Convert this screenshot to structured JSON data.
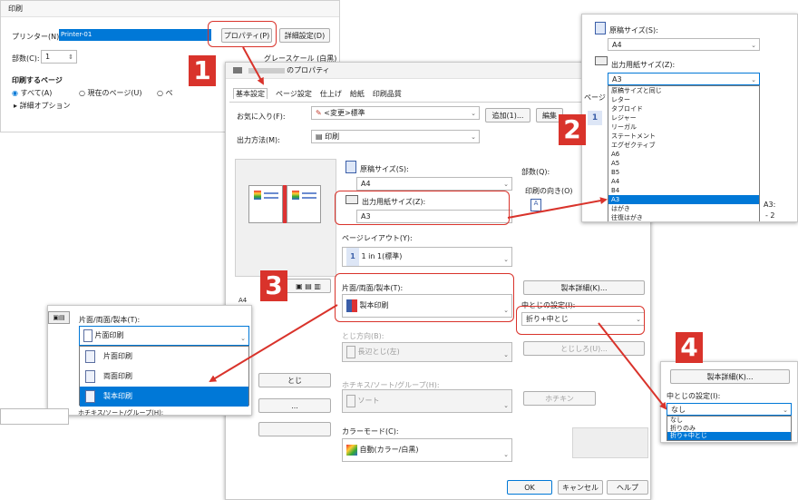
{
  "print_dialog": {
    "title": "印刷",
    "printer_label": "プリンター(N):",
    "printer_value": "Printer-01",
    "properties_button": "プロパティ(P)",
    "advanced_button": "詳細設定(D)",
    "copies_label": "部数(C):",
    "copies_value": "1",
    "grayscale_label": "グレースケール (白黒) で",
    "pages_heading": "印刷するページ",
    "radio_all": "すべて(A)",
    "radio_current": "現在のページ(U)",
    "radio_pages": "ペ",
    "more_options": "詳細オプション"
  },
  "badges": [
    "1",
    "2",
    "3",
    "4"
  ],
  "properties": {
    "title_suffix": "のプロパティ",
    "tabs": [
      "基本設定",
      "ページ設定",
      "仕上げ",
      "給紙",
      "印刷品質"
    ],
    "favorites_label": "お気に入り(F):",
    "favorites_value": "<変更>標準",
    "add_button": "追加(1)...",
    "edit_button": "編集",
    "output_label": "出力方法(M):",
    "output_value": "印刷",
    "original_size_label": "原稿サイズ(S):",
    "original_size_value": "A4",
    "copies_label": "部数(Q):",
    "orientation_label": "印刷の向き(O)",
    "output_paper_label": "出力用紙サイズ(Z):",
    "output_paper_value": "A3",
    "page_layout_label": "ページレイアウト(Y):",
    "page_layout_num": "1",
    "page_layout_value": "1 in 1(標準)",
    "sided_label": "片面/両面/製本(T):",
    "sided_value": "製本印刷",
    "booklet_detail_button": "製本詳細(K)...",
    "center_binding_label": "中とじの設定(I):",
    "center_binding_value": "折り+中とじ",
    "binding_location_label": "とじ方向(B):",
    "binding_location_value": "長辺とじ(左)",
    "binding_margin_button": "とじしろ(U)...",
    "staple_label": "ホチキス/ソート/グループ(H):",
    "staple_value": "ソート",
    "staple_button": "ホチキン",
    "color_mode_label": "カラーモード(C):",
    "color_mode_value": "自動(カラー/白黒)",
    "left_preview_button": "とじ",
    "left_button_2": "...",
    "a4_note": "A4",
    "ok_button": "OK",
    "cancel_button": "キャンセル",
    "help_button": "ヘルプ"
  },
  "paper_popup": {
    "original_size_label": "原稿サイズ(S):",
    "original_size_value": "A4",
    "output_paper_label": "出力用紙サイズ(Z):",
    "output_paper_value": "A3",
    "page_label": "ページ",
    "num_1": "1",
    "options": [
      "原稿サイズと同じ",
      "レター",
      "タブロイド",
      "レジャー",
      "リーガル",
      "ステートメント",
      "エグゼクティブ",
      "A6",
      "A5",
      "B5",
      "A4",
      "B4",
      "A3",
      "はがき",
      "往復はがき"
    ],
    "selected_index": 12,
    "side_texts": [
      "A3:",
      "- 2"
    ]
  },
  "sided_popup": {
    "label": "片面/両面/製本(T):",
    "value": "片面印刷",
    "options": [
      "片面印刷",
      "両面印刷",
      "製本印刷"
    ],
    "selected_index": 2,
    "staple_label": "ホチキス/ソート/グループ(H):"
  },
  "binding_popup": {
    "detail_button": "製本詳細(K)...",
    "label": "中とじの設定(I):",
    "value": "なし",
    "options": [
      "なし",
      "折りのみ",
      "折り+中とじ"
    ],
    "selected_index": 2
  },
  "colors": {
    "highlight": "#d9332b",
    "selection": "#0078d7",
    "printer_field": "#0078d7"
  }
}
